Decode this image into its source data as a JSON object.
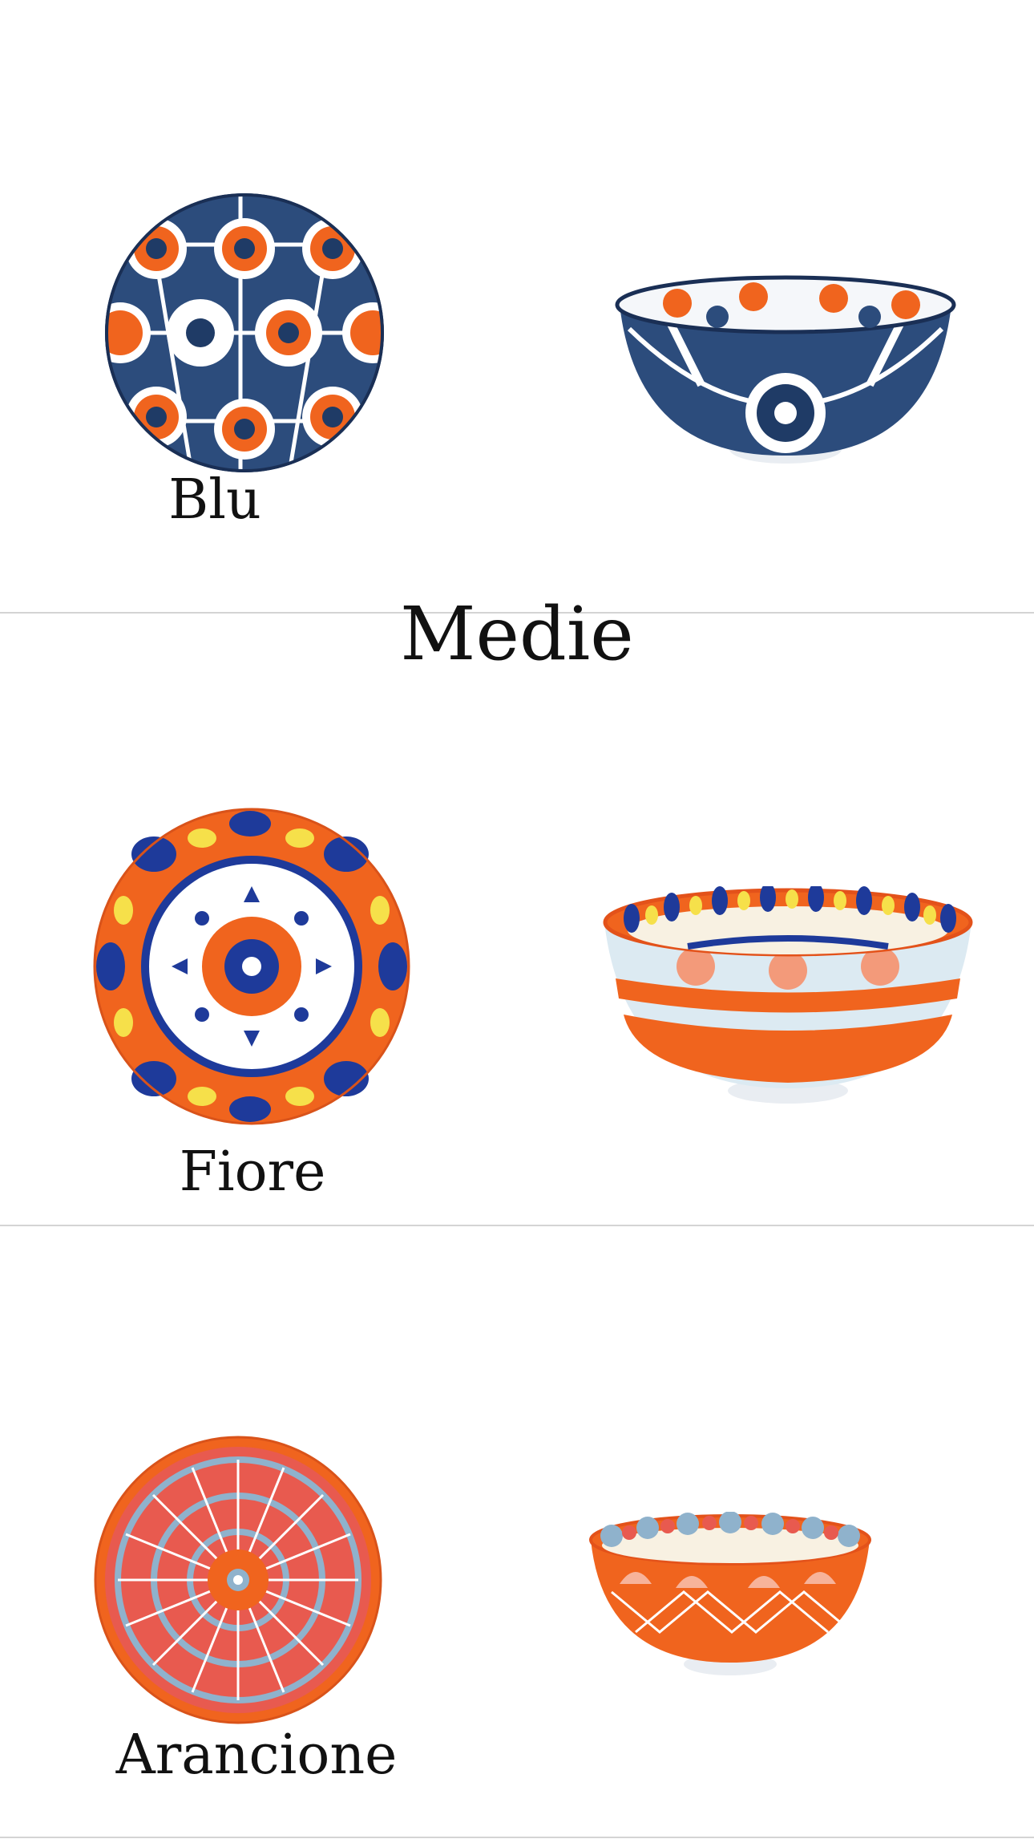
{
  "sections": [
    {
      "label": "Blu"
    },
    {
      "label": "Fiore"
    },
    {
      "label": "Arancione"
    }
  ],
  "heading": "Medie",
  "colors": {
    "blue_dark": "#1f3b66",
    "blue_royal": "#1e3a9a",
    "orange": "#f0641e",
    "yellow": "#f6e04a",
    "coral": "#e85a4f",
    "sky": "#8fb2cc",
    "white": "#ffffff"
  },
  "icons": [
    "bowl-blu-top-image",
    "bowl-blu-side-image",
    "bowl-fiore-top-image",
    "bowl-fiore-side-image",
    "bowl-arancione-top-image",
    "bowl-arancione-side-image"
  ]
}
